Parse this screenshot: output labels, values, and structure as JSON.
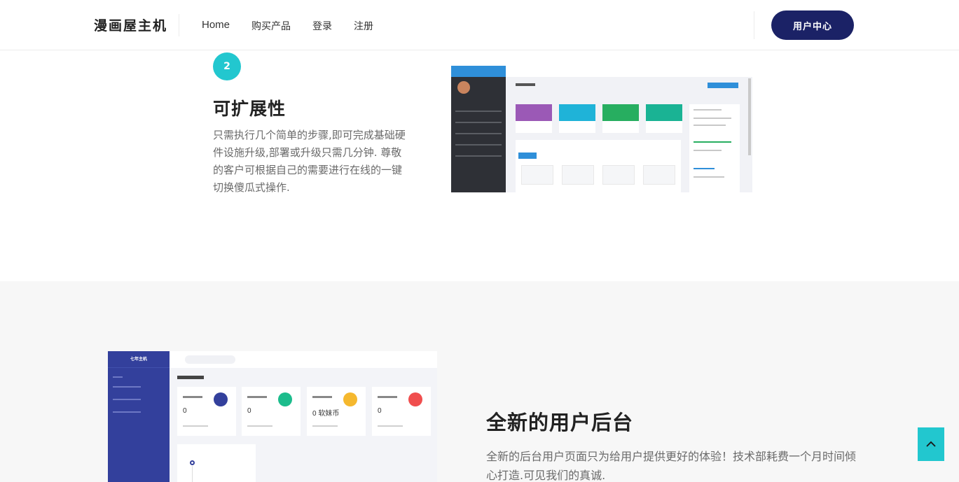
{
  "header": {
    "brand": "漫画屋主机",
    "nav": [
      {
        "label": "Home"
      },
      {
        "label": "购买产品"
      },
      {
        "label": "登录"
      },
      {
        "label": "注册"
      }
    ],
    "user_center_label": "用户中心"
  },
  "feature_scalability": {
    "step_number": "2",
    "title": "可扩展性",
    "description": "只需执行几个简单的步骤,即可完成基础硬件设施升级,部署或升级只需几分钟. 尊敬的客户可根据自己的需要进行在线的一键切换傻瓜式操作."
  },
  "feature_user_backend": {
    "title": "全新的用户后台",
    "description": "全新的后台用户页面只为给用户提供更好的体验！技术部耗费一个月时间倾心打造.可见我们的真诚."
  },
  "mock_dashboard": {
    "sidebar_title": "七年主机",
    "cards": [
      {
        "value": "0",
        "icon_color": "#33409c"
      },
      {
        "value": "0",
        "icon_color": "#1cbc8c"
      },
      {
        "value": "0 软妹币",
        "icon_color": "#f5b82e"
      },
      {
        "value": "0",
        "icon_color": "#f04e4e"
      }
    ]
  },
  "back_to_top_icon": "chevron-up-icon",
  "colors": {
    "accent": "#22c7cf",
    "primary_button": "#1b2266"
  }
}
